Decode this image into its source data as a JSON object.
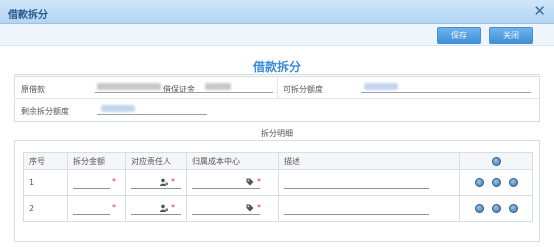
{
  "dialog": {
    "title": "借款拆分",
    "close_glyph": "✕"
  },
  "toolbar": {
    "save_label": "保存",
    "close_label": "关闭"
  },
  "form": {
    "heading": "借款拆分",
    "original_loan_label": "原借款",
    "original_loan_value_visible": "借保证金",
    "splittable_amount_label": "可拆分额度",
    "remaining_amount_label": "剩余拆分额度"
  },
  "detail": {
    "section_title": "拆分明细",
    "columns": [
      "序号",
      "拆分金额",
      "对应责任人",
      "归属成本中心",
      "描述"
    ],
    "rows": [
      {
        "index": "1"
      },
      {
        "index": "2"
      }
    ],
    "required_mark": "*"
  },
  "colors": {
    "accent": "#3a8dd6",
    "required": "#e03030"
  }
}
